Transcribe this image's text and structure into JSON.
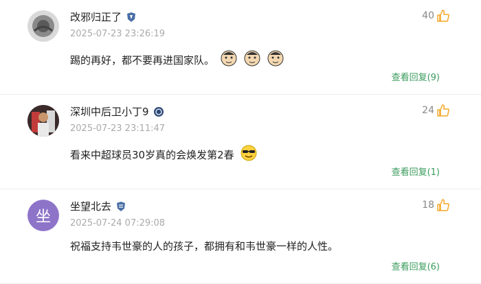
{
  "comments": [
    {
      "username": "改邪归正了",
      "badge_icon": "shield-badge-icon",
      "timestamp": "2025-07-23 23:26:19",
      "content": "踢的再好，都不要再进国家队。",
      "emoji_icons": [
        "face-emoji-icon",
        "face-emoji-icon",
        "face-emoji-icon"
      ],
      "likes": "40",
      "reply_label": "查看回复(9)"
    },
    {
      "username": "深圳中后卫小丁9",
      "badge_icon": "circle-badge-icon",
      "timestamp": "2025-07-23 23:11:47",
      "content": "看来中超球员30岁真的会焕发第2春",
      "emoji_icons": [
        "sunglasses-emoji-icon"
      ],
      "likes": "24",
      "reply_label": "查看回复(1)"
    },
    {
      "avatar_text": "坐",
      "username": "坐望北去",
      "badge_icon": "shield-badge-icon",
      "timestamp": "2025-07-24 07:29:08",
      "content": "祝福支持韦世豪的人的孩子，都拥有和韦世豪一样的人性。",
      "likes": "18",
      "reply_label": "查看回复(6)"
    }
  ],
  "colors": {
    "accent_green": "#3a9b5c",
    "like_orange": "#f5a623",
    "avatar_purple": "#8e74c9"
  }
}
